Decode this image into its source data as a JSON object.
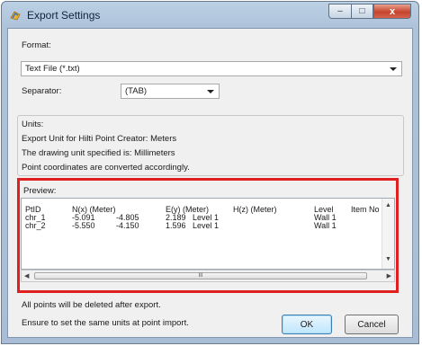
{
  "window": {
    "title": "Export Settings",
    "close_glyph": "x",
    "minimize_glyph": "–",
    "maximize_glyph": "□"
  },
  "format": {
    "label": "Format:",
    "value": "Text File (*.txt)"
  },
  "separator": {
    "label": "Separator:",
    "value": "(TAB)"
  },
  "units": {
    "label": "Units:",
    "lines": [
      "Export Unit for Hilti Point Creator: Meters",
      "The drawing unit specified is: Millimeters",
      "Point coordinates are converted accordingly."
    ]
  },
  "preview": {
    "label": "Preview:",
    "headers": [
      "PtID",
      "N(x) (Meter)",
      "E(y) (Meter)",
      "H(z) (Meter)",
      "Level",
      "Item No"
    ],
    "rows": [
      {
        "ptid": "chr_1",
        "n1": "-5.091",
        "n2": "-4.805",
        "e": "2.189",
        "lvl": "Level 1",
        "level": "Wall 1"
      },
      {
        "ptid": "chr_2",
        "n1": "-5.550",
        "n2": "-4.150",
        "e": "1.596",
        "lvl": "Level 1",
        "level": "Wall 1"
      }
    ],
    "scroll_grip": "III"
  },
  "notes": [
    "All points will be deleted after export.",
    "Ensure to set the same units at point import."
  ],
  "buttons": {
    "ok": "OK",
    "cancel": "Cancel"
  },
  "colors": {
    "highlight": "#e02020",
    "title_bar": "#bcd0e4",
    "close_button": "#c6452f"
  }
}
